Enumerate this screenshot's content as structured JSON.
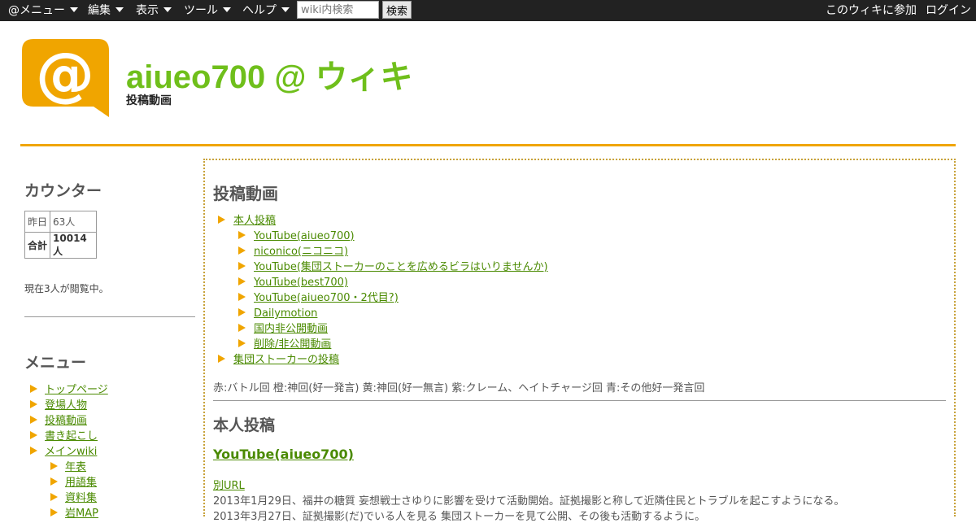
{
  "topbar": {
    "menus": [
      "@メニュー",
      "編集",
      "表示",
      "ツール",
      "ヘルプ"
    ],
    "search_placeholder": "wiki内検索",
    "search_button": "検索",
    "join": "このウィキに参加",
    "login": "ログイン"
  },
  "header": {
    "title": "aiueo700 @ ウィキ",
    "subtitle": "投稿動画",
    "logo_color": "#f0a500",
    "title_color": "#6fbf1b"
  },
  "sidebar": {
    "counter_heading": "カウンター",
    "counter": {
      "yesterday_label": "昨日",
      "yesterday_value": "63人",
      "total_label": "合計",
      "total_value": "10014人"
    },
    "viewing": "現在3人が閲覧中。",
    "menu_heading": "メニュー",
    "menu_items": [
      "トップページ",
      "登場人物",
      "投稿動画",
      "書き起こし",
      "メインwiki"
    ],
    "menu_subitems": [
      "年表",
      "用語集",
      "資料集",
      "岩MAP"
    ]
  },
  "main": {
    "heading": "投稿動画",
    "toc": {
      "top1": "本人投稿",
      "children": [
        "YouTube(aiueo700)",
        "niconico(ニコニコ)",
        "YouTube(集団ストーカーのことを広めるビラはいりませんか)",
        "YouTube(best700)",
        "YouTube(aiueo700・2代目?)",
        "Dailymotion",
        "国内非公開動画",
        "削除/非公開動画"
      ],
      "top2": "集団ストーカーの投稿"
    },
    "legend": "赤:バトル回 橙:神回(好一発言) 黄:神回(好一無言) 紫:クレーム、ヘイトチャージ回 青:その他好一発言回",
    "section_heading": "本人投稿",
    "subsection_heading": "YouTube(aiueo700)",
    "alt_url": "別URL",
    "para1": "2013年1月29日、福井の糖質 妄想戦士さゆりに影響を受けて活動開始。証拠撮影と称して近隣住民とトラブルを起こすようになる。",
    "para2": "2013年3月27日、証拠撮影(だ)でいる人を見る 集団ストーカーを見て公開、その後も活動するように。"
  },
  "colors": {
    "accent": "#f0a500",
    "link": "#4a8a00",
    "topbar": "#222222"
  }
}
